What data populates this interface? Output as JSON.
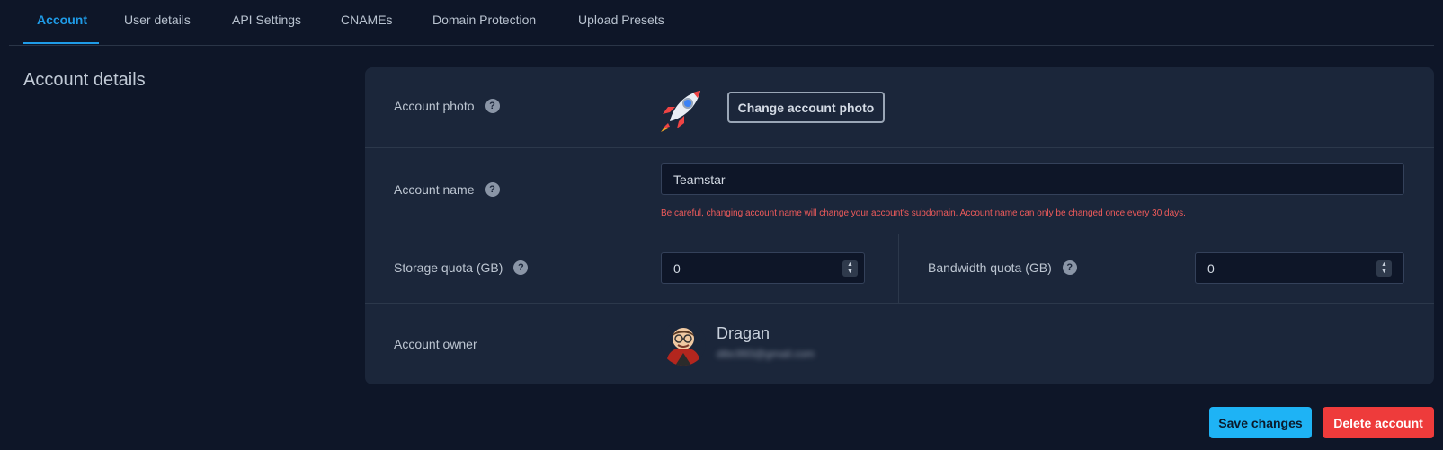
{
  "tabs": [
    {
      "label": "Account",
      "active": true
    },
    {
      "label": "User details"
    },
    {
      "label": "API Settings"
    },
    {
      "label": "CNAMEs"
    },
    {
      "label": "Domain Protection"
    },
    {
      "label": "Upload Presets"
    }
  ],
  "section_title": "Account details",
  "account_photo": {
    "label": "Account photo",
    "help": "?",
    "button_label": "Change account photo",
    "icon": "rocket-icon"
  },
  "account_name": {
    "label": "Account name",
    "help": "?",
    "value": "Teamstar",
    "warning": "Be careful, changing account name will change your account's subdomain. Account name can only be changed once every 30 days."
  },
  "storage_quota": {
    "label": "Storage quota (GB)",
    "help": "?",
    "value": "0"
  },
  "bandwidth_quota": {
    "label": "Bandwidth quota (GB)",
    "help": "?",
    "value": "0"
  },
  "account_owner": {
    "label": "Account owner",
    "name": "Dragan",
    "email": "dibc993@gmail.com"
  },
  "actions": {
    "save_label": "Save changes",
    "delete_label": "Delete account"
  },
  "colors": {
    "accent": "#1f9ce8",
    "save": "#1eb3f5",
    "delete": "#ee3b3b",
    "warning": "#ef5b5b",
    "background": "#0e1628",
    "card": "#1b263a"
  }
}
